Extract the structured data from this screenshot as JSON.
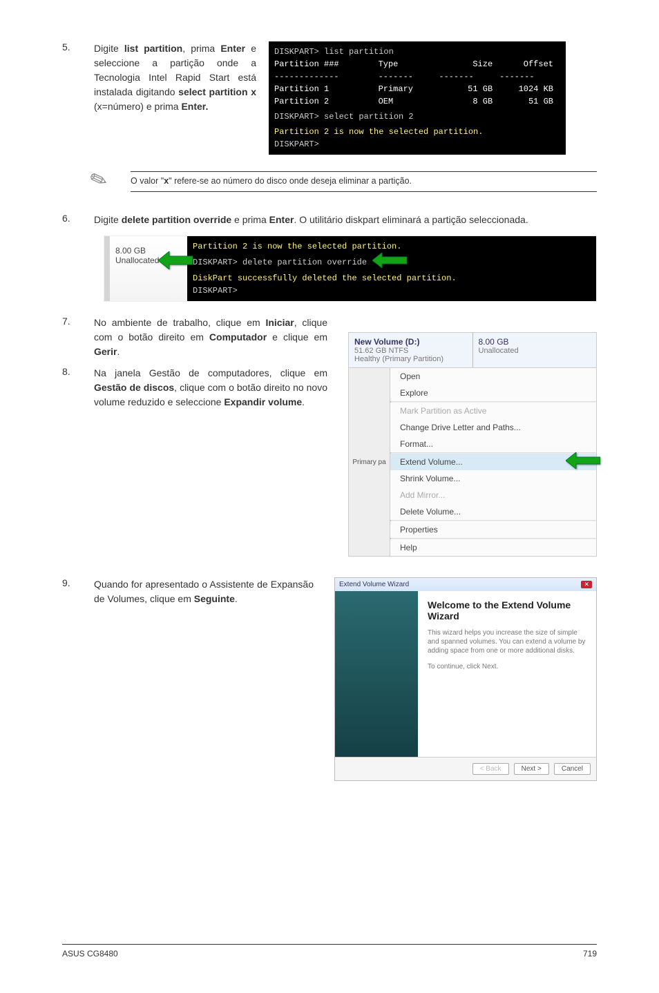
{
  "step5": {
    "num": "5.",
    "text_before_bold1": "Digite ",
    "bold1": "list partition",
    "between1": ", prima ",
    "bold2": "Enter",
    "between2": " e seleccione a partição onde a Tecnologia Intel Rapid Start está instalada digitando ",
    "bold3": "select partition x",
    "between3": " (x=número) e prima ",
    "bold4": "Enter."
  },
  "term1": {
    "line1": "DISKPART> list partition",
    "hdr_partition": "Partition ###",
    "hdr_type": "Type",
    "hdr_size": "Size",
    "hdr_offset": "Offset",
    "dash": "-------------",
    "row1_p": "Partition 1",
    "row1_t": "Primary",
    "row1_s": "51 GB",
    "row1_o": "1024 KB",
    "row2_p": "Partition 2",
    "row2_t": "OEM",
    "row2_s": "8 GB",
    "row2_o": "51 GB",
    "line_select": "DISKPART> select partition 2",
    "line_result": "Partition 2 is now the selected partition.",
    "line_prompt": "DISKPART>"
  },
  "note": {
    "text_before": "O valor \"",
    "bold": "x",
    "text_after": "\" refere-se ao número do disco onde deseja eliminar a partição."
  },
  "step6": {
    "num": "6.",
    "t1": "Digite ",
    "b1": "delete partition override",
    "t2": " e prima ",
    "b2": "Enter",
    "t3": ". O utilitário diskpart eliminará a partição seleccionada."
  },
  "unalloc": {
    "size": "8.00 GB",
    "label": "Unallocated"
  },
  "term2": {
    "l1": "Partition 2 is now the selected partition.",
    "l2": "DISKPART> delete partition override",
    "l3": "DiskPart successfully deleted the selected partition.",
    "l4": "DISKPART>"
  },
  "step7": {
    "num": "7.",
    "t1": "No ambiente de trabalho, clique em ",
    "b1": "Iniciar",
    "t2": ", clique com o botão direito em ",
    "b2": "Computador",
    "t3": " e clique em ",
    "b3": "Gerir",
    "t4": "."
  },
  "step8": {
    "num": "8.",
    "t1": "Na janela Gestão de computadores, clique em ",
    "b1": "Gestão de discos",
    "t2": ", clique com o botão direito no novo volume reduzido e seleccione ",
    "b2": "Expandir volume",
    "t3": "."
  },
  "ctxpanel": {
    "vol_title": "New Volume  (D:)",
    "vol_size": "51.62 GB NTFS",
    "vol_status": "Healthy (Primary Partition)",
    "alloc_size": "8.00 GB",
    "alloc_label": "Unallocated",
    "side": "Primary pa",
    "items": {
      "open": "Open",
      "explore": "Explore",
      "mark": "Mark Partition as Active",
      "change": "Change Drive Letter and Paths...",
      "format": "Format...",
      "extend": "Extend Volume...",
      "shrink": "Shrink Volume...",
      "mirror": "Add Mirror...",
      "delete": "Delete Volume...",
      "props": "Properties",
      "help": "Help"
    }
  },
  "step9": {
    "num": "9.",
    "t1": "Quando for apresentado o Assistente de Expansão de Volumes, clique em ",
    "b1": "Seguinte",
    "t2": "."
  },
  "wizard": {
    "title": "Extend Volume Wizard",
    "heading": "Welcome to the Extend Volume Wizard",
    "desc1": "This wizard helps you increase the size of simple and spanned volumes. You can extend a volume by adding space from one or more additional disks.",
    "desc2": "To continue, click Next.",
    "btn_back": "< Back",
    "btn_next": "Next >",
    "btn_cancel": "Cancel"
  },
  "footer": {
    "left": "ASUS CG8480",
    "right": "719"
  }
}
